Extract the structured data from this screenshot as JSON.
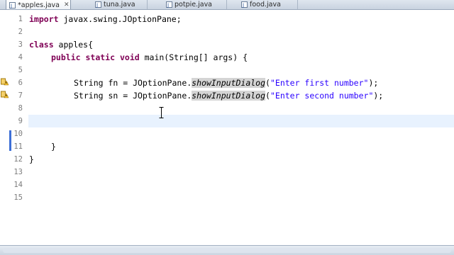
{
  "tabs": [
    {
      "label": "*apples.java",
      "active": true
    },
    {
      "label": "tuna.java",
      "active": false
    },
    {
      "label": "potpie.java",
      "active": false
    },
    {
      "label": "food.java",
      "active": false
    }
  ],
  "line_numbers": [
    "1",
    "2",
    "3",
    "4",
    "5",
    "6",
    "7",
    "8",
    "9",
    "10",
    "11",
    "12",
    "13",
    "14",
    "15"
  ],
  "code": {
    "line1": {
      "kw": "import",
      "rest": " javax.swing.JOptionPane;"
    },
    "line3": {
      "kw": "class",
      "rest": " apples{"
    },
    "line4": {
      "kw1": "public",
      "kw2": "static",
      "kw3": "void",
      "rest": " main(String[] args) {"
    },
    "line6": {
      "pre": "String fn = JOptionPane.",
      "method": "showInputDialog",
      "open": "(",
      "str": "\"Enter first number\"",
      "close": ");"
    },
    "line7": {
      "pre": "String sn = JOptionPane.",
      "method": "showInputDialog",
      "open": "(",
      "str": "\"Enter second number\"",
      "close": ");"
    },
    "line11": {
      "text": "}"
    },
    "line12": {
      "text": "}"
    }
  },
  "colors": {
    "keyword": "#7f0055",
    "string": "#2a00ff",
    "current_line": "#e8f2fe",
    "fold_marker": "#3d6fd6"
  },
  "icons": {
    "tab": "java-file-icon",
    "gutter_warning": "warning-icon"
  }
}
